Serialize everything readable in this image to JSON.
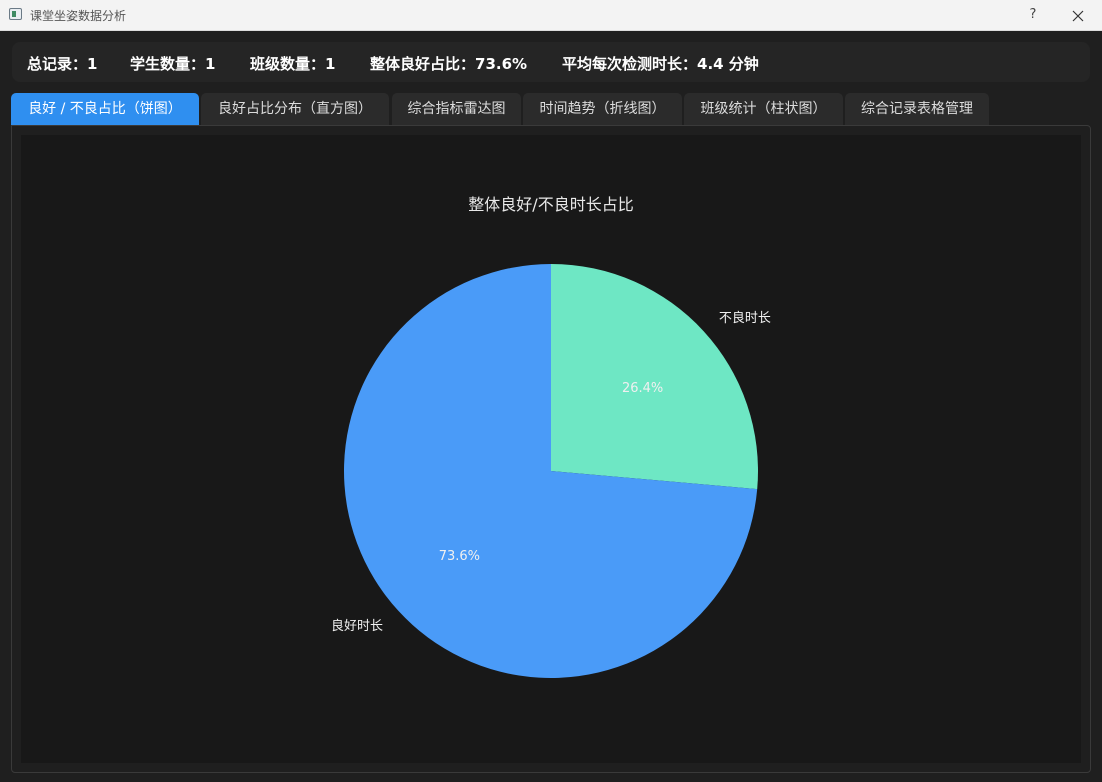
{
  "window": {
    "title": "课堂坐姿数据分析",
    "help_label": "?"
  },
  "stats": {
    "total_records": "总记录：1",
    "student_count": "学生数量：1",
    "class_count": "班级数量：1",
    "good_ratio": "整体良好占比：73.6%",
    "avg_duration": "平均每次检测时长：4.4 分钟"
  },
  "tabs": [
    {
      "label": "良好 / 不良占比（饼图）",
      "active": true
    },
    {
      "label": "良好占比分布（直方图）",
      "active": false
    },
    {
      "label": "综合指标雷达图",
      "active": false
    },
    {
      "label": "时间趋势（折线图）",
      "active": false
    },
    {
      "label": "班级统计（柱状图）",
      "active": false
    },
    {
      "label": "综合记录表格管理",
      "active": false
    }
  ],
  "chart_data": {
    "type": "pie",
    "title": "整体良好/不良时长占比",
    "slices": [
      {
        "label": "不良时长",
        "value": 26.4,
        "pct_label": "26.4%",
        "color": "#6ee7c4"
      },
      {
        "label": "良好时长",
        "value": 73.6,
        "pct_label": "73.6%",
        "color": "#4a9bf8"
      }
    ],
    "start_angle": "12 o'clock",
    "direction": "clockwise"
  },
  "colors": {
    "accent": "#2f8ff0",
    "background": "#1f1f1f",
    "chart_background": "#181818"
  }
}
